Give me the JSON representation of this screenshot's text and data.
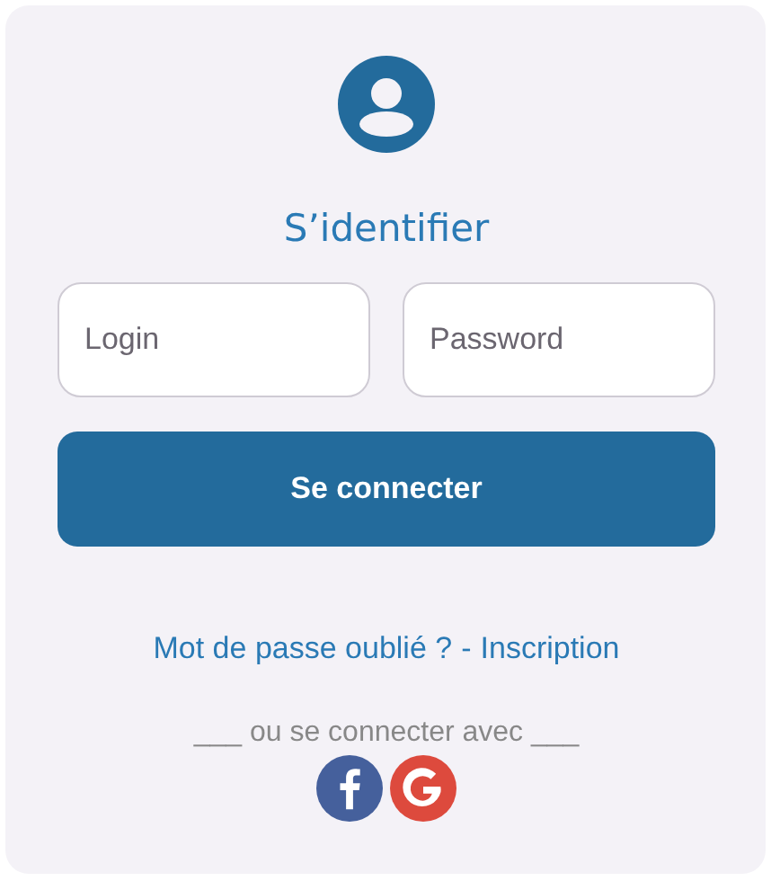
{
  "title": "S’identifier",
  "fields": [
    {
      "placeholder": "Login"
    },
    {
      "placeholder": "Password"
    }
  ],
  "submit": "Se connecter",
  "links": [
    {
      "label": "Mot de passe oublié ?"
    },
    {
      "label": "Inscription"
    }
  ],
  "link_separator": "-",
  "social_caption": "___ ou se connecter avec ___",
  "social": [
    {
      "kind": "facebook"
    },
    {
      "kind": "google"
    }
  ]
}
